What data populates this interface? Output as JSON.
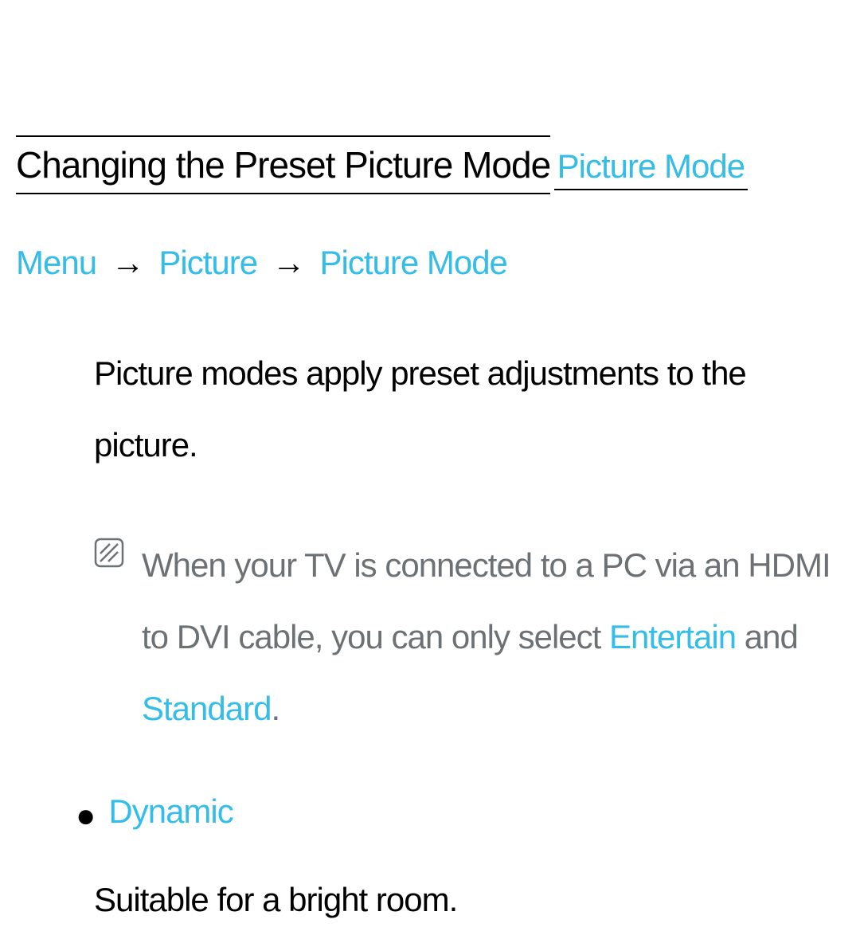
{
  "title": "Changing the Preset Picture Mode",
  "section": "Picture Mode",
  "breadcrumb": {
    "step1": "Menu",
    "arrow": "→",
    "step2": "Picture",
    "step3": "Picture Mode"
  },
  "intro": "Picture modes apply preset adjustments to the picture.",
  "note": {
    "part1": "When your TV is connected to a PC via an HDMI to DVI cable, you can only select ",
    "entertain": "Entertain",
    "and": " and ",
    "standard": "Standard",
    "period": "."
  },
  "mode": {
    "name": "Dynamic",
    "description": "Suitable for a bright room."
  }
}
